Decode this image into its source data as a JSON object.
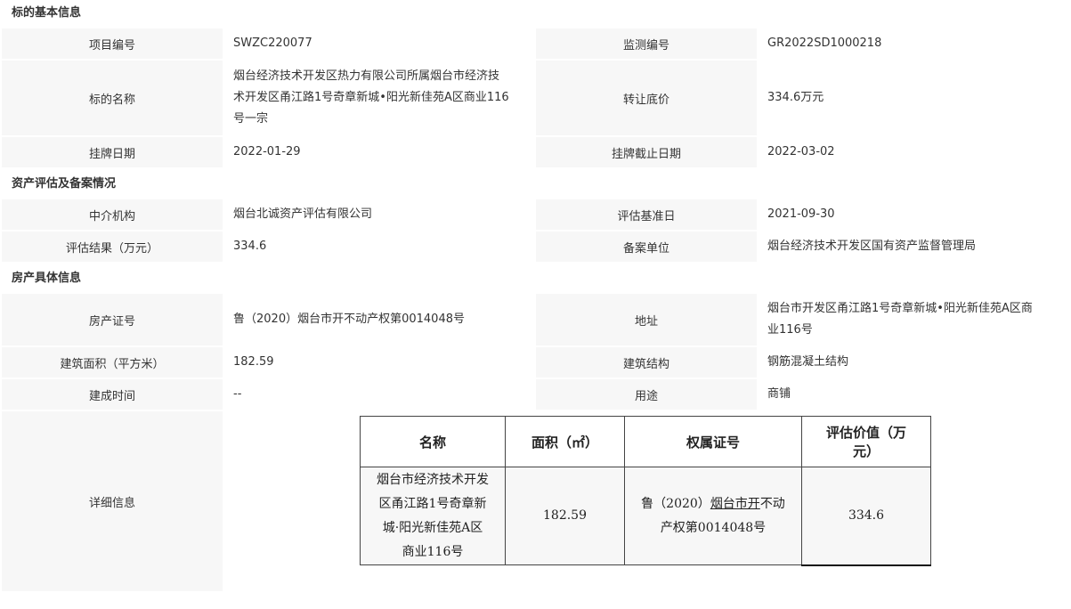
{
  "sections": {
    "basic": "标的基本信息",
    "appraisal": "资产评估及备案情况",
    "property": "房产具体信息"
  },
  "basic": {
    "project_no_label": "项目编号",
    "project_no": "SWZC220077",
    "monitor_no_label": "监测编号",
    "monitor_no": "GR2022SD1000218",
    "name_label": "标的名称",
    "name_lines": [
      "烟台经济技术开发区热力有限公司所属烟台市经济技",
      "术开发区甬江路1号奇章新城•阳光新佳苑A区商业116",
      "号一宗"
    ],
    "reserve_price_label": "转让底价",
    "reserve_price": "334.6万元",
    "listing_date_label": "挂牌日期",
    "listing_date": "2022-01-29",
    "listing_end_label": "挂牌截止日期",
    "listing_end": "2022-03-02"
  },
  "appraisal": {
    "agency_label": "中介机构",
    "agency": "烟台北诚资产评估有限公司",
    "base_date_label": "评估基准日",
    "base_date": "2021-09-30",
    "result_label": "评估结果（万元）",
    "result": "334.6",
    "filing_label": "备案单位",
    "filing": "烟台经济技术开发区国有资产监督管理局"
  },
  "property": {
    "cert_label": "房产证号",
    "cert": "鲁（2020）烟台市开不动产权第0014048号",
    "address_label": "地址",
    "address_lines": [
      "烟台市开发区甬江路1号奇章新城•阳光新佳苑A区商",
      "业116号"
    ],
    "area_label": "建筑面积（平方米）",
    "area": "182.59",
    "structure_label": "建筑结构",
    "structure": "钢筋混凝土结构",
    "built_label": "建成时间",
    "built": "--",
    "usage_label": "用途",
    "usage": "商铺",
    "detail_label": "详细信息"
  },
  "detail_table": {
    "headers": [
      "名称",
      "面积（㎡）",
      "权属证号",
      "评估价值（万元）"
    ],
    "header_lines_4": [
      "评估价值（万",
      "元）"
    ],
    "row": {
      "name_lines": [
        "烟台市经济技术开发",
        "区甬江路1号奇章新",
        "城·阳光新佳苑A区",
        "商业116号"
      ],
      "area": "182.59",
      "cert_prefix": "鲁（2020）",
      "cert_link": "烟台市开",
      "cert_suffix": "不动",
      "cert_line2": "产权第0014048号",
      "value": "334.6"
    }
  }
}
